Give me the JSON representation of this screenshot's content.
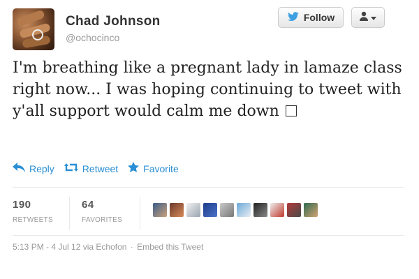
{
  "user": {
    "name": "Chad Johnson",
    "handle": "@ochocinco"
  },
  "buttons": {
    "follow_label": "Follow"
  },
  "tweet": {
    "text": "I'm breathing like a pregnant lady in lamaze class right now... I was hoping continuing to tweet with y'all support would calm me down"
  },
  "actions": {
    "reply": "Reply",
    "retweet": "Retweet",
    "favorite": "Favorite"
  },
  "stats": {
    "retweets_count": "190",
    "retweets_label": "RETWEETS",
    "favorites_count": "64",
    "favorites_label": "FAVORITES"
  },
  "meta": {
    "timestamp": "5:13 PM - 4 Jul 12",
    "via": "via Echofon",
    "separator": "·",
    "embed": "Embed this Tweet"
  },
  "colors": {
    "link": "#2a8fd4",
    "twitter_bird": "#3ea0e3"
  },
  "icons": [
    "twitter-bird-icon",
    "user-icon",
    "caret-down-icon",
    "reply-icon",
    "retweet-icon",
    "star-icon"
  ]
}
